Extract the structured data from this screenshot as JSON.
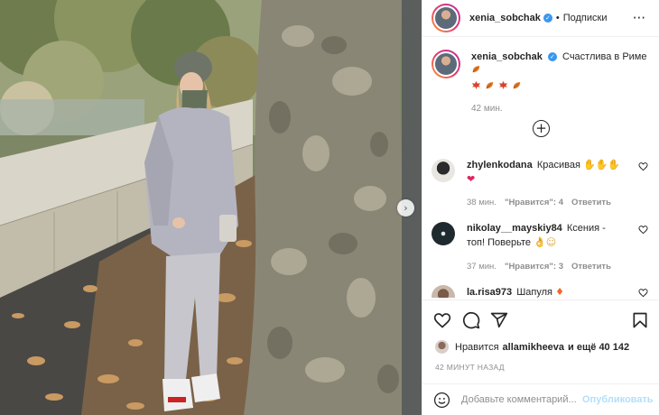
{
  "post": {
    "username": "xenia_sobchak",
    "separator": "•",
    "follow_label": "Подписки",
    "more_icon": "more-horizontal-icon"
  },
  "caption": {
    "username": "xenia_sobchak",
    "text": "Счастлива в Риме",
    "emoji_names": [
      "maple-leaf-emoji",
      "fallen-leaf-emoji",
      "maple-leaf-emoji",
      "fallen-leaf-emoji",
      "fallen-leaf-emoji"
    ],
    "time": "42 мин."
  },
  "comments": [
    {
      "username": "zhylenkodana",
      "text": "Красивая",
      "time": "38 мин.",
      "likes": "\"Нравится\": 4",
      "reply": "Ответить"
    },
    {
      "username": "nikolay__mayskiy84",
      "text": "Ксения - топ! Поверьте",
      "time": "37 мин.",
      "likes": "\"Нравится\": 3",
      "reply": "Ответить"
    },
    {
      "username": "la.risa973",
      "text": "Шапуля"
    }
  ],
  "likes": {
    "prefix": "Нравится",
    "user": "allamikheeva",
    "suffix": "и ещё 40 142"
  },
  "time_ago": "42 МИНУТ НАЗАД",
  "comment_input": {
    "placeholder": "Добавьте комментарий...",
    "publish_label": "Опубликовать"
  },
  "colors": {
    "link_blue": "#3897f0",
    "publish_disabled": "#b2dffc",
    "muted": "#8e8e8e"
  }
}
